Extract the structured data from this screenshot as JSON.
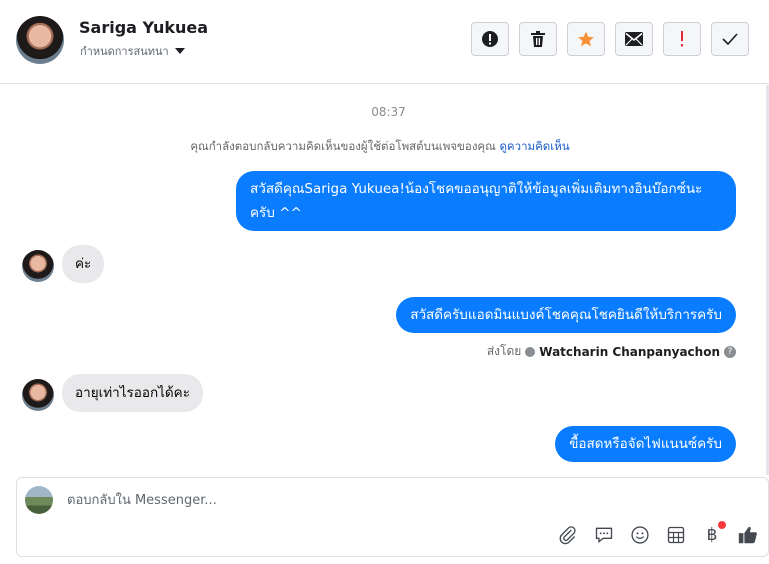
{
  "header": {
    "name": "Sariga Yukuea",
    "subtitle": "กำหนดการสนทนา",
    "tools": [
      {
        "icon": "alert-circle-icon"
      },
      {
        "icon": "trash-icon"
      },
      {
        "icon": "star-icon",
        "color": "#f7923b"
      },
      {
        "icon": "mail-icon"
      },
      {
        "icon": "exclamation-icon",
        "color": "#e4293b"
      },
      {
        "icon": "check-icon"
      }
    ]
  },
  "chat": {
    "time": "08:37",
    "notice_text": "คุณกำลังตอบกลับความคิดเห็นของผู้ใช้ต่อโพสต์บนเพจของคุณ",
    "notice_link": "ดูความคิดเห็น",
    "messages": [
      {
        "from": "page",
        "text": "สวัสดีคุณSariga Yukuea!น้องโชคขออนุญาติให้ข้อมูลเพิ่มเติมทางอินบ๊อกซ์นะครับ ^^"
      },
      {
        "from": "user",
        "text": "ค่ะ"
      },
      {
        "from": "page",
        "text": "สวัสดีครับแอดมินแบงค์โชคคุณโชคยินดีให้บริการครับ"
      },
      {
        "from": "user",
        "text": "อายุเท่าไรออกได้คะ"
      },
      {
        "from": "page",
        "text": "ขื้อสดหรือจัดไฟแนนซ์ครับ"
      }
    ],
    "sent_by_label": "ส่งโดย",
    "sent_by_name": "Watcharin Chanpanyachon"
  },
  "composer": {
    "placeholder": "ตอบกลับใน Messenger...",
    "value": "",
    "icons": [
      "paperclip-icon",
      "chat-bubble-icon",
      "emoji-icon",
      "table-icon",
      "baht-icon",
      "like-icon"
    ]
  },
  "colors": {
    "accent": "#0a7cff",
    "incoming_bubble": "#e9e9eb"
  }
}
